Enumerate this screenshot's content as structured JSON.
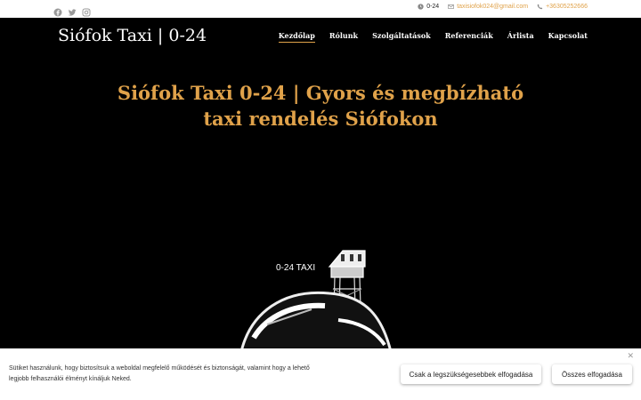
{
  "topbar": {
    "social_icons": [
      "facebook-icon",
      "twitter-icon",
      "instagram-icon"
    ],
    "hours": "0-24",
    "email": "taxisiofok024@gmail.com",
    "phone": "+36305252666"
  },
  "header": {
    "logo": "Siófok Taxi | 0-24",
    "nav": [
      {
        "label": "Kezdőlap",
        "active": true
      },
      {
        "label": "Rólunk"
      },
      {
        "label": "Szolgáltatások"
      },
      {
        "label": "Referenciák"
      },
      {
        "label": "Árlista"
      },
      {
        "label": "Kapcsolat"
      }
    ]
  },
  "hero": {
    "title_line1": "Siófok Taxi 0-24 | Gyors és megbízható",
    "title_line2": "taxi rendelés Siófokon",
    "image_text": "0-24 TAXI"
  },
  "cookie": {
    "text": "Sütiket használunk, hogy biztosítsuk a weboldal megfelelő működését és biztonságát, valamint hogy a lehető legjobb felhasználói élményt kínáljuk Neked.",
    "btn_necessary": "Csak a legszükségesebbek elfogadása",
    "btn_all": "Összes elfogadása",
    "close": "✕"
  },
  "colors": {
    "accent": "#e0a24a",
    "background": "#000000"
  }
}
